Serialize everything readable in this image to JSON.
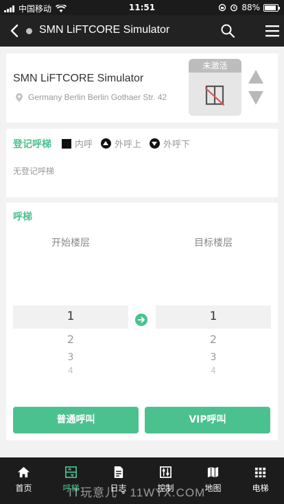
{
  "status_bar": {
    "carrier": "中国移动",
    "time": "11:51",
    "battery": "88%"
  },
  "nav": {
    "title": "SMN LiFTCORE Simulator"
  },
  "device": {
    "name": "SMN LiFTCORE Simulator",
    "address": "Germany Berlin Berlin Gothaer Str. 42",
    "state_label": "未激活"
  },
  "registered_calls": {
    "title": "登记呼梯",
    "legend": {
      "inner": "内呼",
      "outer_up": "外呼上",
      "outer_down": "外呼下"
    },
    "empty_text": "无登记呼梯"
  },
  "call": {
    "title": "呼梯",
    "start_label": "开始楼层",
    "target_label": "目标楼层",
    "start_floors": [
      "1",
      "2",
      "3",
      "4"
    ],
    "target_floors": [
      "1",
      "2",
      "3",
      "4"
    ],
    "normal_button": "普通呼叫",
    "vip_button": "VIP呼叫"
  },
  "tabs": [
    {
      "label": "首页",
      "icon": "home-icon"
    },
    {
      "label": "呼梯",
      "icon": "call-elevator-icon"
    },
    {
      "label": "日志",
      "icon": "log-icon"
    },
    {
      "label": "控制",
      "icon": "control-icon"
    },
    {
      "label": "地图",
      "icon": "map-icon"
    },
    {
      "label": "电梯",
      "icon": "elevator-grid-icon"
    }
  ],
  "active_tab": 1,
  "watermark": "IT玩意儿 • 11WYX.COM",
  "colors": {
    "accent": "#4cc190",
    "nav_bg": "#222222",
    "inactive": "#bdbdbd",
    "alert": "#e05555"
  }
}
